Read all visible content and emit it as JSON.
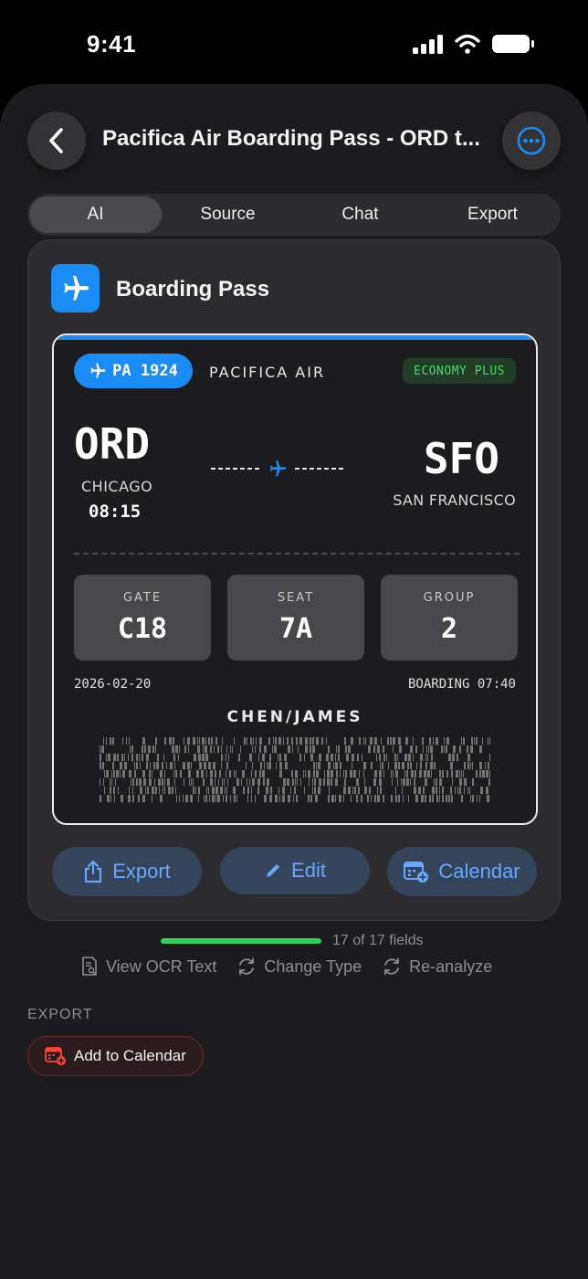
{
  "status": {
    "time": "9:41"
  },
  "nav": {
    "title": "Pacifica Air Boarding Pass - ORD t..."
  },
  "tabs": [
    {
      "label": "AI",
      "active": true
    },
    {
      "label": "Source",
      "active": false
    },
    {
      "label": "Chat",
      "active": false
    },
    {
      "label": "Export",
      "active": false
    }
  ],
  "card": {
    "title": "Boarding Pass",
    "icon": "airplane-icon"
  },
  "pass": {
    "flight": "PA 1924",
    "airline": "PACIFICA AIR",
    "class": "ECONOMY PLUS",
    "origin": {
      "code": "ORD",
      "city": "CHICAGO",
      "time": "08:15"
    },
    "destination": {
      "code": "SFO",
      "city": "SAN FRANCISCO"
    },
    "gate": {
      "label": "GATE",
      "value": "C18"
    },
    "seat": {
      "label": "SEAT",
      "value": "7A"
    },
    "group": {
      "label": "GROUP",
      "value": "2"
    },
    "date": "2026-02-20",
    "boarding": "BOARDING 07:40",
    "passenger": "CHEN/JAMES"
  },
  "actions": {
    "export": "Export",
    "edit": "Edit",
    "calendar": "Calendar"
  },
  "progress": {
    "text": "17 of 17 fields",
    "fraction": 1.0
  },
  "tools": {
    "ocr": "View OCR Text",
    "change": "Change Type",
    "reanalyze": "Re-analyze"
  },
  "export_section": {
    "label": "EXPORT",
    "add_calendar": "Add to Calendar"
  },
  "colors": {
    "accent": "#1a8cf5",
    "success": "#30d158",
    "badge_green": "#4cd964",
    "danger": "#ff453a"
  }
}
